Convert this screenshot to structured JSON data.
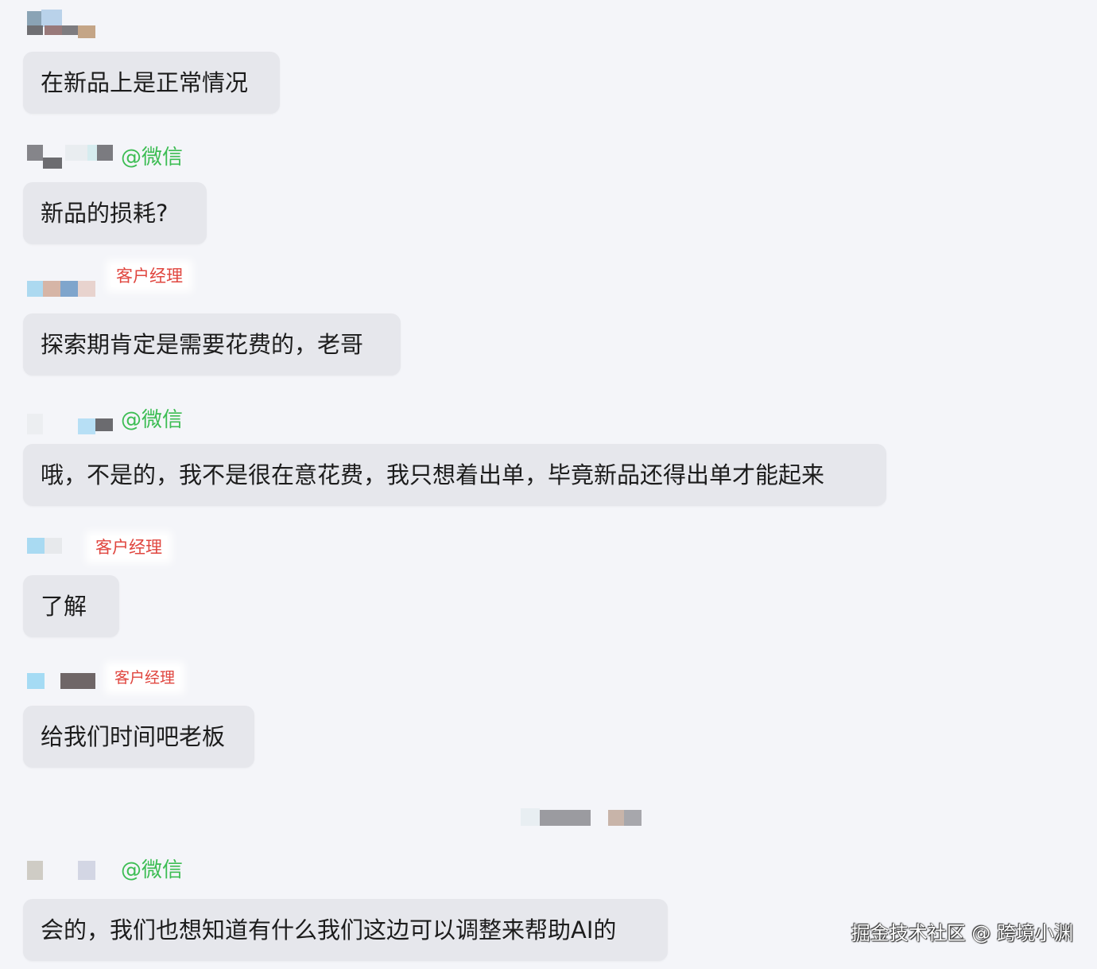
{
  "chat": {
    "messages": [
      {
        "sender_tag": "",
        "text": "在新品上是正常情况"
      },
      {
        "sender_tag": "@微信",
        "text": "新品的损耗?"
      },
      {
        "sender_tag": "客户经理",
        "text": "探索期肯定是需要花费的，老哥"
      },
      {
        "sender_tag": "@微信",
        "text": "哦，不是的，我不是很在意花费，我只想着出单，毕竟新品还得出单才能起来"
      },
      {
        "sender_tag": "客户经理",
        "text": "了解"
      },
      {
        "sender_tag": "客户经理",
        "text": "给我们时间吧老板"
      },
      {
        "sender_tag": "@微信",
        "text": "会的，我们也想知道有什么我们这边可以调整来帮助AI的"
      }
    ]
  },
  "watermark": "掘金技术社区 @ 跨境小渊",
  "colors": {
    "background": "#f4f5f9",
    "bubble": "#e6e7ec",
    "wechat_tag": "#3dbd54",
    "manager_tag": "#e0463f"
  },
  "icons": [
    "blurred-avatar-name"
  ]
}
